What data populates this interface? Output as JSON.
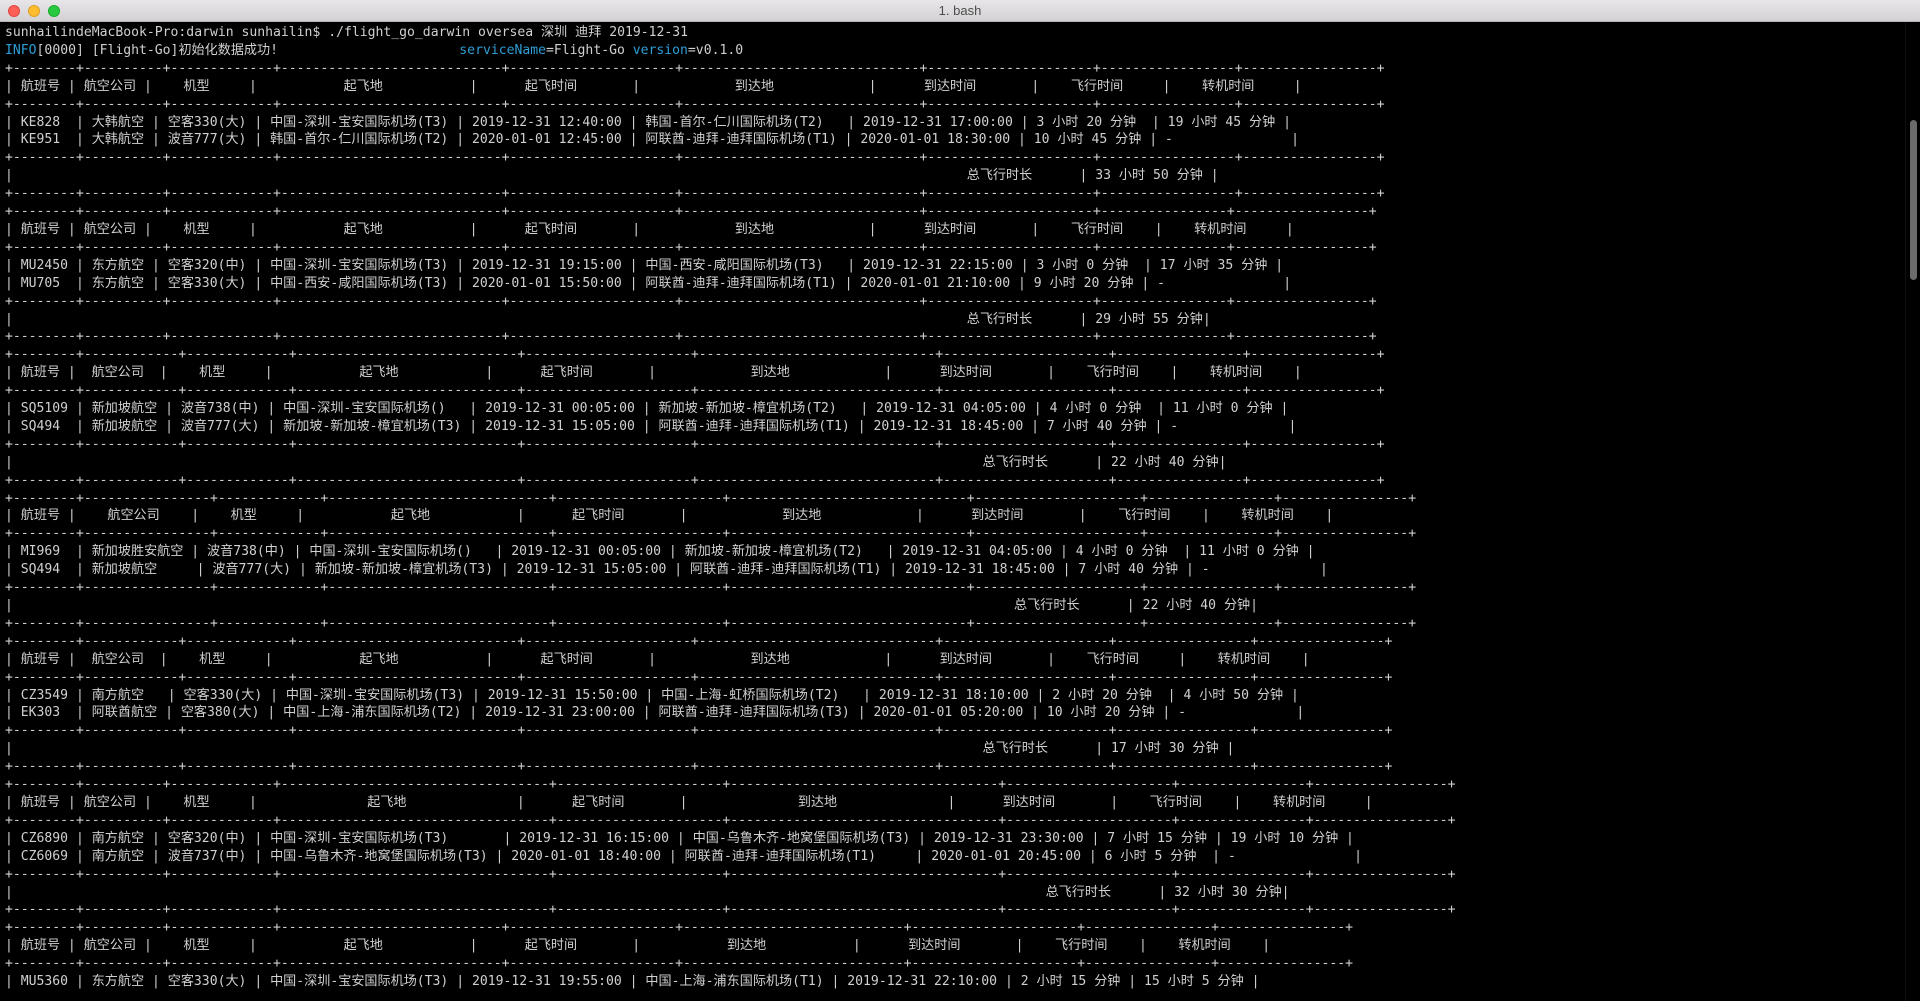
{
  "window": {
    "title": "1. bash"
  },
  "prompt": {
    "text": "sunhailindeMacBook-Pro:darwin sunhailin$ ",
    "command": "./flight_go_darwin oversea 深圳 迪拜 2019-12-31"
  },
  "log": {
    "level": "INFO",
    "rest": "[0000] [Flight-Go]初始化数据成功!",
    "service_key": "serviceName",
    "service_value": "Flight-Go",
    "version_key": "version",
    "version_value": "v0.1.0"
  },
  "headers": [
    "航班号",
    "航空公司",
    "机型",
    "起飞地",
    "起飞时间",
    "到达地",
    "到达时间",
    "飞行时间",
    "转机时间"
  ],
  "total_label": "总飞行时长",
  "itineraries": [
    {
      "rows": [
        [
          "KE828",
          "大韩航空",
          "空客330(大)",
          "中国-深圳-宝安国际机场(T3)",
          "2019-12-31 12:40:00",
          "韩国-首尔-仁川国际机场(T2)",
          "2019-12-31 17:00:00",
          "3 小时 20 分钟",
          "19 小时 45 分钟"
        ],
        [
          "KE951",
          "大韩航空",
          "波音777(大)",
          "韩国-首尔-仁川国际机场(T2)",
          "2020-01-01 12:45:00",
          "阿联酋-迪拜-迪拜国际机场(T1)",
          "2020-01-01 18:30:00",
          "10 小时 45 分钟",
          "-"
        ]
      ],
      "total": "33 小时 50 分钟"
    },
    {
      "rows": [
        [
          "MU2450",
          "东方航空",
          "空客320(中)",
          "中国-深圳-宝安国际机场(T3)",
          "2019-12-31 19:15:00",
          "中国-西安-咸阳国际机场(T3)",
          "2019-12-31 22:15:00",
          "3 小时 0 分钟",
          "17 小时 35 分钟"
        ],
        [
          "MU705",
          "东方航空",
          "空客330(大)",
          "中国-西安-咸阳国际机场(T3)",
          "2020-01-01 15:50:00",
          "阿联酋-迪拜-迪拜国际机场(T1)",
          "2020-01-01 21:10:00",
          "9 小时 20 分钟",
          "-"
        ]
      ],
      "total": "29 小时 55 分钟"
    },
    {
      "rows": [
        [
          "SQ5109",
          "新加坡航空",
          "波音738(中)",
          "中国-深圳-宝安国际机场()",
          "2019-12-31 00:05:00",
          "新加坡-新加坡-樟宜机场(T2)",
          "2019-12-31 04:05:00",
          "4 小时 0 分钟",
          "11 小时 0 分钟"
        ],
        [
          "SQ494",
          "新加坡航空",
          "波音777(大)",
          "新加坡-新加坡-樟宜机场(T3)",
          "2019-12-31 15:05:00",
          "阿联酋-迪拜-迪拜国际机场(T1)",
          "2019-12-31 18:45:00",
          "7 小时 40 分钟",
          "-"
        ]
      ],
      "total": "22 小时 40 分钟"
    },
    {
      "rows": [
        [
          "MI969",
          "新加坡胜安航空",
          "波音738(中)",
          "中国-深圳-宝安国际机场()",
          "2019-12-31 00:05:00",
          "新加坡-新加坡-樟宜机场(T2)",
          "2019-12-31 04:05:00",
          "4 小时 0 分钟",
          "11 小时 0 分钟"
        ],
        [
          "SQ494",
          "新加坡航空",
          "波音777(大)",
          "新加坡-新加坡-樟宜机场(T3)",
          "2019-12-31 15:05:00",
          "阿联酋-迪拜-迪拜国际机场(T1)",
          "2019-12-31 18:45:00",
          "7 小时 40 分钟",
          "-"
        ]
      ],
      "total": "22 小时 40 分钟"
    },
    {
      "rows": [
        [
          "CZ3549",
          "南方航空",
          "空客330(大)",
          "中国-深圳-宝安国际机场(T3)",
          "2019-12-31 15:50:00",
          "中国-上海-虹桥国际机场(T2)",
          "2019-12-31 18:10:00",
          "2 小时 20 分钟",
          "4 小时 50 分钟"
        ],
        [
          "EK303",
          "阿联酋航空",
          "空客380(大)",
          "中国-上海-浦东国际机场(T2)",
          "2019-12-31 23:00:00",
          "阿联酋-迪拜-迪拜国际机场(T3)",
          "2020-01-01 05:20:00",
          "10 小时 20 分钟",
          "-"
        ]
      ],
      "total": "17 小时 30 分钟"
    },
    {
      "rows": [
        [
          "CZ6890",
          "南方航空",
          "空客320(中)",
          "中国-深圳-宝安国际机场(T3)",
          "2019-12-31 16:15:00",
          "中国-乌鲁木齐-地窝堡国际机场(T3)",
          "2019-12-31 23:30:00",
          "7 小时 15 分钟",
          "19 小时 10 分钟"
        ],
        [
          "CZ6069",
          "南方航空",
          "波音737(中)",
          "中国-乌鲁木齐-地窝堡国际机场(T3)",
          "2020-01-01 18:40:00",
          "阿联酋-迪拜-迪拜国际机场(T1)",
          "2020-01-01 20:45:00",
          "6 小时 5 分钟",
          "-"
        ]
      ],
      "total": "32 小时 30 分钟"
    },
    {
      "rows": [
        [
          "MU5360",
          "东方航空",
          "空客330(大)",
          "中国-深圳-宝安国际机场(T3)",
          "2019-12-31 19:55:00",
          "中国-上海-浦东国际机场(T1)",
          "2019-12-31 22:10:00",
          "2 小时 15 分钟",
          "15 小时 5 分钟"
        ]
      ],
      "total": ""
    }
  ]
}
